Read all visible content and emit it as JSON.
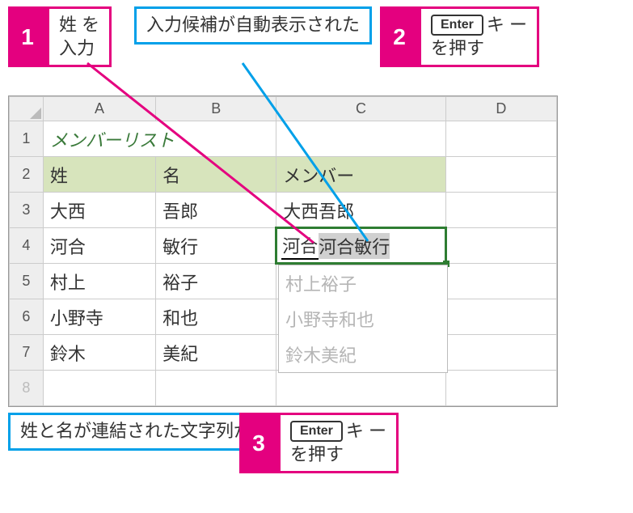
{
  "callouts": {
    "step1": {
      "num": "1",
      "text_l1": "姓 を",
      "text_l2": "入力"
    },
    "note1": {
      "text_l1": "入力候補が自動表示",
      "text_l2": "された"
    },
    "step2": {
      "num": "2",
      "key": "Enter",
      "text_l1": "キ ー",
      "text_l2": "を押す"
    },
    "note2": {
      "text_l1": "姓と名が連結された",
      "text_l2": "文字列が入力された"
    },
    "step3": {
      "num": "3",
      "key": "Enter",
      "text_l1": "キ ー",
      "text_l2": "を押す"
    }
  },
  "sheet": {
    "cols": [
      "A",
      "B",
      "C",
      "D"
    ],
    "title": "メンバーリスト",
    "headers": {
      "a": "姓",
      "b": "名",
      "c": "メンバー"
    },
    "rows": [
      {
        "n": "3",
        "a": "大西",
        "b": "吾郎",
        "c": "大西吾郎"
      },
      {
        "n": "4",
        "a": "河合",
        "b": "敏行",
        "typed": "河合",
        "suggest": "河合敏行"
      },
      {
        "n": "5",
        "a": "村上",
        "b": "裕子",
        "ff": "村上裕子"
      },
      {
        "n": "6",
        "a": "小野寺",
        "b": "和也",
        "ff": "小野寺和也"
      },
      {
        "n": "7",
        "a": "鈴木",
        "b": "美紀",
        "ff": "鈴木美紀"
      }
    ],
    "rowlabels": {
      "r1": "1",
      "r2": "2",
      "r8": "8"
    }
  }
}
